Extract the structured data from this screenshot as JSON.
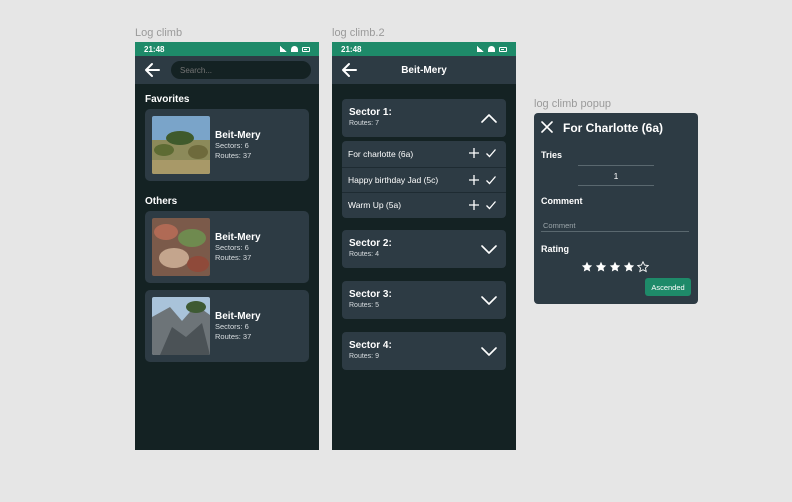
{
  "frames": {
    "log_climb": "Log climb",
    "log_climb_2": "log climb.2",
    "log_climb_popup": "log climb popup"
  },
  "status": {
    "time": "21:48"
  },
  "screen1": {
    "search_placeholder": "Search...",
    "favorites_title": "Favorites",
    "others_title": "Others",
    "favorites": [
      {
        "name": "Beit-Mery",
        "sectors": "Sectors: 6",
        "routes": "Routes: 37",
        "image": "landscape-photo"
      }
    ],
    "others": [
      {
        "name": "Beit-Mery",
        "sectors": "Sectors: 6",
        "routes": "Routes: 37",
        "image": "rock-foliage-photo"
      },
      {
        "name": "Beit-Mery",
        "sectors": "Sectors: 6",
        "routes": "Routes: 37",
        "image": "cliff-photo"
      }
    ]
  },
  "screen2": {
    "title": "Beit-Mery",
    "sectors": [
      {
        "title": "Sector 1:",
        "routes": "Routes: 7",
        "expanded": true
      },
      {
        "title": "Sector 2:",
        "routes": "Routes: 4",
        "expanded": false
      },
      {
        "title": "Sector 3:",
        "routes": "Routes: 5",
        "expanded": false
      },
      {
        "title": "Sector 4:",
        "routes": "Routes: 9",
        "expanded": false
      }
    ],
    "routes": [
      {
        "name": "For charlotte (6a)"
      },
      {
        "name": "Happy birthday Jad (5c)"
      },
      {
        "name": "Warm Up (5a)"
      }
    ]
  },
  "popup": {
    "title": "For Charlotte (6a)",
    "tries_label": "Tries",
    "tries_value": "1",
    "comment_label": "Comment",
    "comment_placeholder": "Comment",
    "rating_label": "Rating",
    "rating": 4,
    "rating_max": 5,
    "ascended_label": "Ascended"
  },
  "colors": {
    "background": "#142223",
    "card": "#2d3b44",
    "accent": "#1e8a69",
    "canvas": "#e6e6e6"
  }
}
